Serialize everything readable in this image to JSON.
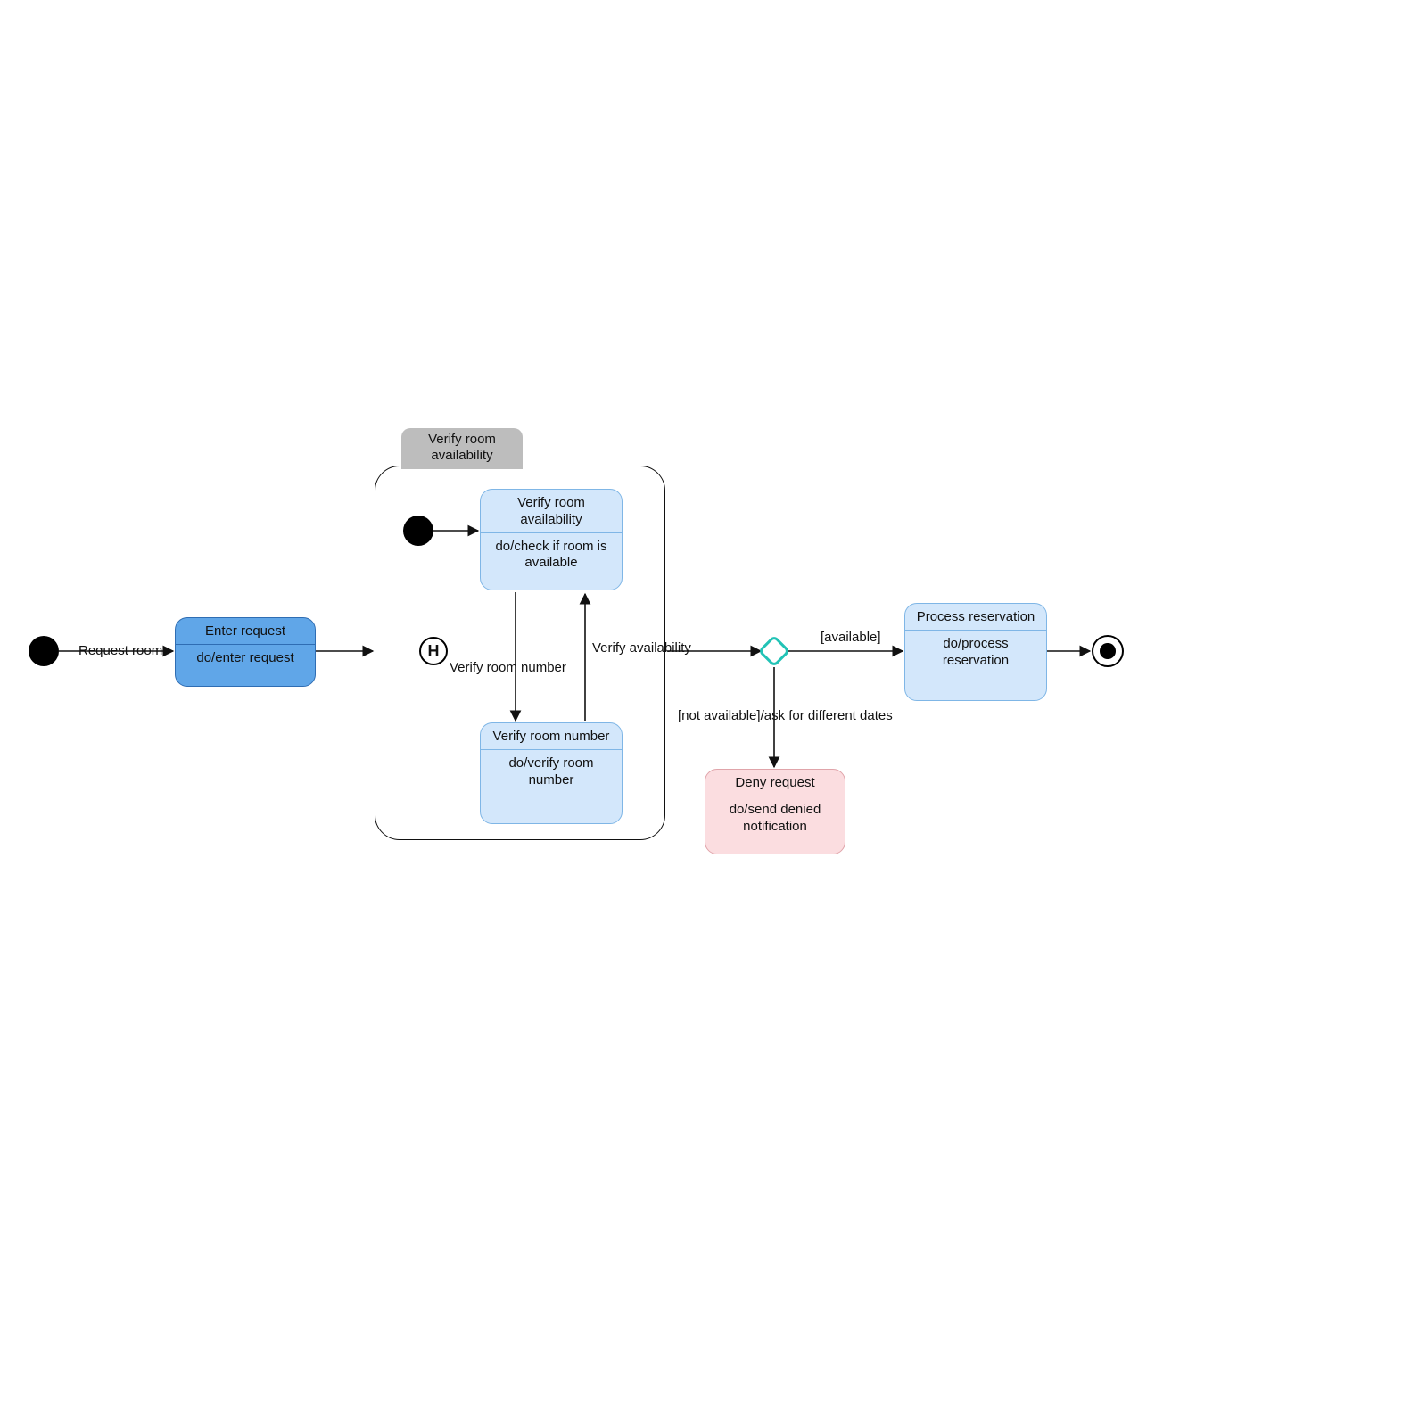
{
  "labels": {
    "requestRoom": "Request room",
    "verifyRoomNumber": "Verify room number",
    "verifyAvailability": "Verify availability",
    "available": "[available]",
    "notAvailable": "[not available]/ask for different dates",
    "historyLetter": "H"
  },
  "compositeLabel": "Verify room\navailability",
  "states": {
    "enterRequest": {
      "title": "Enter request",
      "body": "do/enter request"
    },
    "verifyAvail": {
      "title": "Verify room\navailability",
      "body": "do/check if room\nis available"
    },
    "verifyNumber": {
      "title": "Verify room\nnumber",
      "body": "do/verify room\nnumber"
    },
    "process": {
      "title": "Process\nreservation",
      "body": "do/process\nreservation"
    },
    "deny": {
      "title": "Deny request",
      "body": "do/send denied\nnotification"
    }
  }
}
